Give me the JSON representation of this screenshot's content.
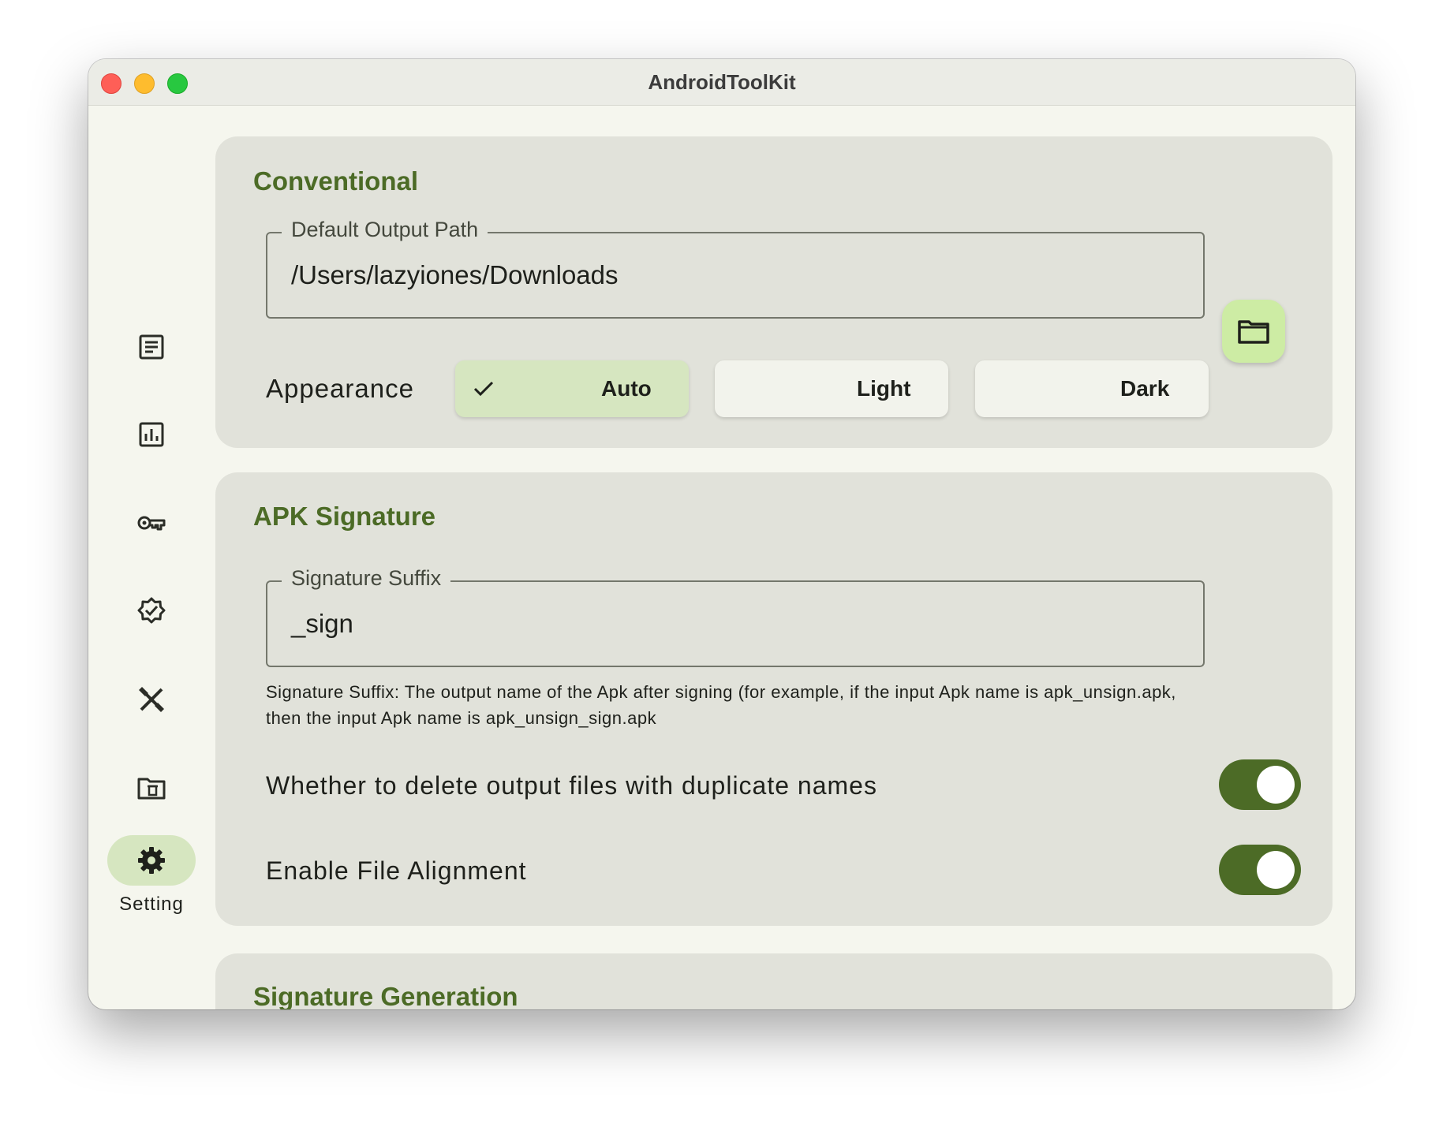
{
  "window": {
    "title": "AndroidToolKit"
  },
  "sidebar": {
    "items": [
      {
        "icon": "document-icon",
        "label": ""
      },
      {
        "icon": "chart-icon",
        "label": ""
      },
      {
        "icon": "key-icon",
        "label": ""
      },
      {
        "icon": "verified-badge-icon",
        "label": ""
      },
      {
        "icon": "design-tools-icon",
        "label": ""
      },
      {
        "icon": "folder-delete-icon",
        "label": ""
      },
      {
        "icon": "gear-icon",
        "label": "Setting",
        "active": true
      }
    ]
  },
  "conventional": {
    "title": "Conventional",
    "output_path_label": "Default Output Path",
    "output_path_value": "/Users/lazyiones/Downloads",
    "appearance_label": "Appearance",
    "appearance_options": [
      "Auto",
      "Light",
      "Dark"
    ],
    "appearance_selected": "Auto"
  },
  "apk_signature": {
    "title": "APK Signature",
    "suffix_label": "Signature Suffix",
    "suffix_value": "_sign",
    "hint": "Signature Suffix: The output name of the Apk after signing (for example, if the input Apk name is apk_unsign.apk, then the input Apk name is apk_unsign_sign.apk",
    "delete_duplicates_label": "Whether to delete output files with duplicate names",
    "delete_duplicates_on": true,
    "file_alignment_label": "Enable File Alignment",
    "file_alignment_on": true
  },
  "signature_generation": {
    "title": "Signature Generation"
  },
  "colors": {
    "accent": "#4c6b26",
    "selected_bg": "#d6e6c0",
    "card_bg": "#e1e2da",
    "window_bg": "#f5f6ee"
  }
}
